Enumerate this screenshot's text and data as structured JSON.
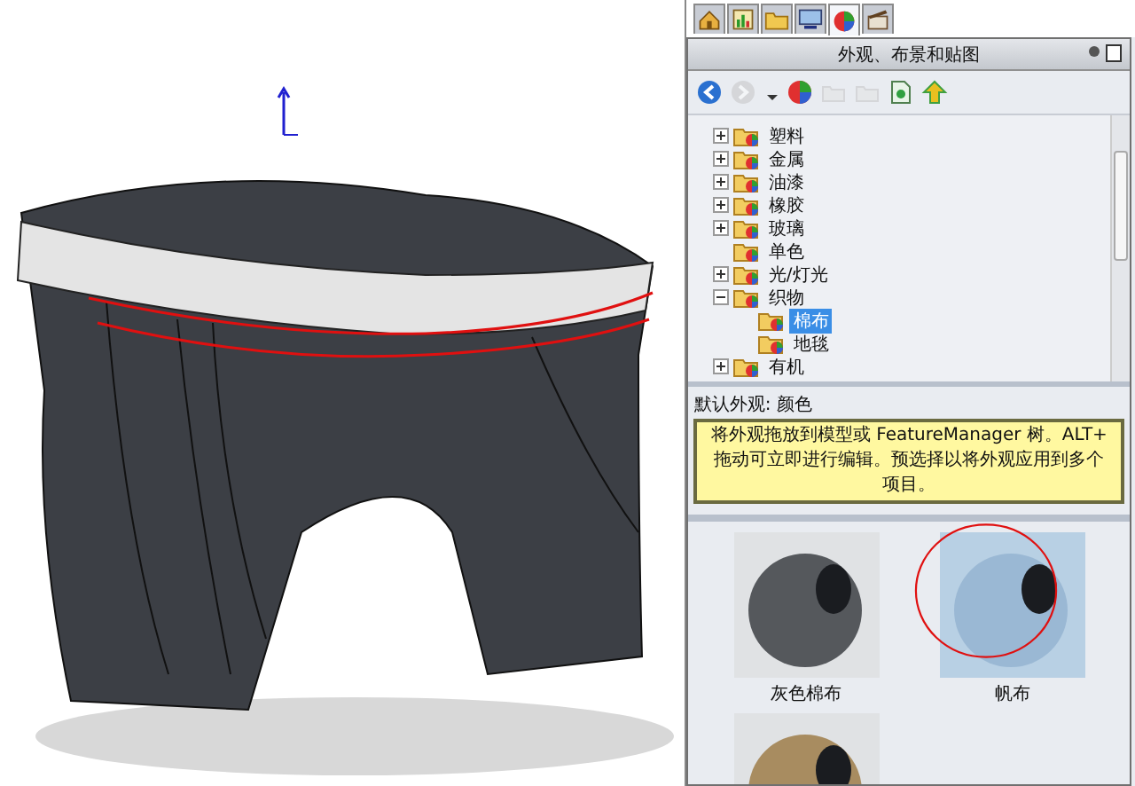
{
  "tabs": [
    {
      "kind": "home",
      "selected": false
    },
    {
      "kind": "tree",
      "selected": false
    },
    {
      "kind": "folder",
      "selected": false
    },
    {
      "kind": "monitor",
      "selected": false
    },
    {
      "kind": "appearance",
      "selected": true
    },
    {
      "kind": "clapper",
      "selected": false
    }
  ],
  "panel": {
    "title": "外观、布景和贴图"
  },
  "toolbar": [
    {
      "kind": "back",
      "disabled": false
    },
    {
      "kind": "forward",
      "disabled": true
    },
    {
      "kind": "caret",
      "disabled": false
    },
    {
      "kind": "appearance",
      "disabled": false
    },
    {
      "kind": "folder",
      "disabled": true
    },
    {
      "kind": "folder",
      "disabled": true
    },
    {
      "kind": "document",
      "disabled": false
    },
    {
      "kind": "up",
      "disabled": false
    }
  ],
  "tree": [
    {
      "label": "塑料",
      "kind": "collapsed",
      "selected": false
    },
    {
      "label": "金属",
      "kind": "collapsed",
      "selected": false
    },
    {
      "label": "油漆",
      "kind": "collapsed",
      "selected": false
    },
    {
      "label": "橡胶",
      "kind": "collapsed",
      "selected": false
    },
    {
      "label": "玻璃",
      "kind": "collapsed",
      "selected": false
    },
    {
      "label": "单色",
      "kind": "leaf",
      "selected": false
    },
    {
      "label": "光/灯光",
      "kind": "collapsed",
      "selected": false
    },
    {
      "label": "织物",
      "kind": "expanded",
      "selected": false,
      "children": [
        {
          "label": "棉布",
          "selected": true
        },
        {
          "label": "地毯",
          "selected": false
        }
      ]
    },
    {
      "label": "有机",
      "kind": "collapsed",
      "selected": false
    }
  ],
  "default_appearance": "默认外观: 颜色",
  "tooltip": "将外观拖放到模型或 FeatureManager 树。ALT+ 拖动可立即进行编辑。预选择以将外观应用到多个项目。",
  "swatches": [
    {
      "label": "灰色棉布",
      "color": "#55585c",
      "circled": false
    },
    {
      "label": "帆布",
      "color": "#9ab8d4",
      "circled": true
    },
    {
      "color": "#a88c60",
      "circled": false
    }
  ]
}
